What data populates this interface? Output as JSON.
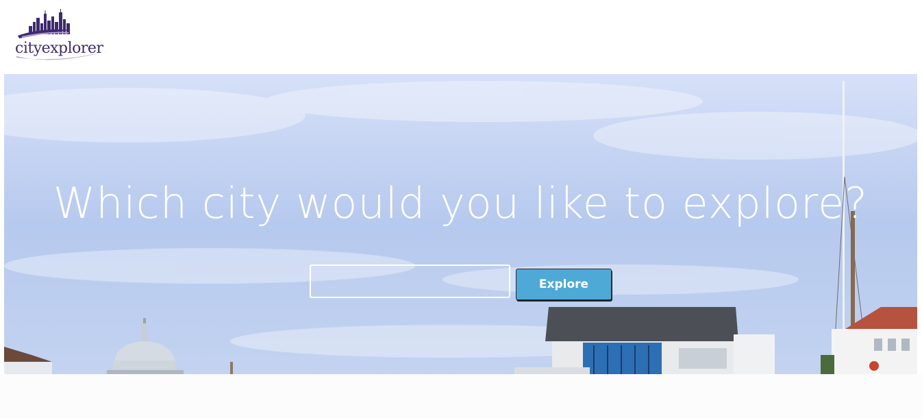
{
  "brand": {
    "logo_text": "cityexplorer",
    "logo_icon": "city-skyline-icon",
    "primary_color": "#3f2a6e",
    "accent_color": "#b59bd6"
  },
  "hero": {
    "title": "Which city would you like to explore?",
    "search": {
      "value": "",
      "placeholder": ""
    },
    "button_label": "Explore",
    "button_color": "#4fa9d6"
  }
}
